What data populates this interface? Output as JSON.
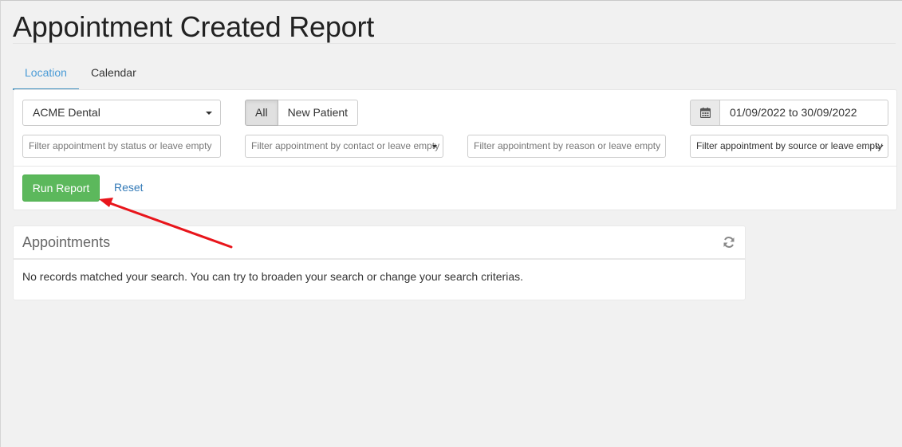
{
  "page": {
    "title": "Appointment Created Report"
  },
  "tabs": [
    {
      "label": "Location",
      "active": true
    },
    {
      "label": "Calendar",
      "active": false
    }
  ],
  "filters": {
    "location_value": "ACME Dental",
    "patient_toggle": {
      "all_label": "All",
      "new_label": "New Patient",
      "selected": "All"
    },
    "date_range_value": "01/09/2022 to 30/09/2022",
    "status_placeholder": "Filter appointment by status or leave empty",
    "contact_placeholder": "Filter appointment by contact or leave empty",
    "reason_placeholder": "Filter appointment by reason or leave empty",
    "source_value": "Filter appointment by source or leave empty"
  },
  "actions": {
    "run_label": "Run Report",
    "reset_label": "Reset"
  },
  "results": {
    "title": "Appointments",
    "empty_message": "No records matched your search. You can try to broaden your search or change your search criterias."
  },
  "icons": {
    "date": "calendar-icon",
    "refresh": "refresh-icon",
    "annotation": "red-arrow"
  },
  "colors": {
    "accent": "#4a9bd6",
    "run_button": "#5cb85c",
    "link": "#337ab7",
    "annotation": "#e8151b"
  }
}
